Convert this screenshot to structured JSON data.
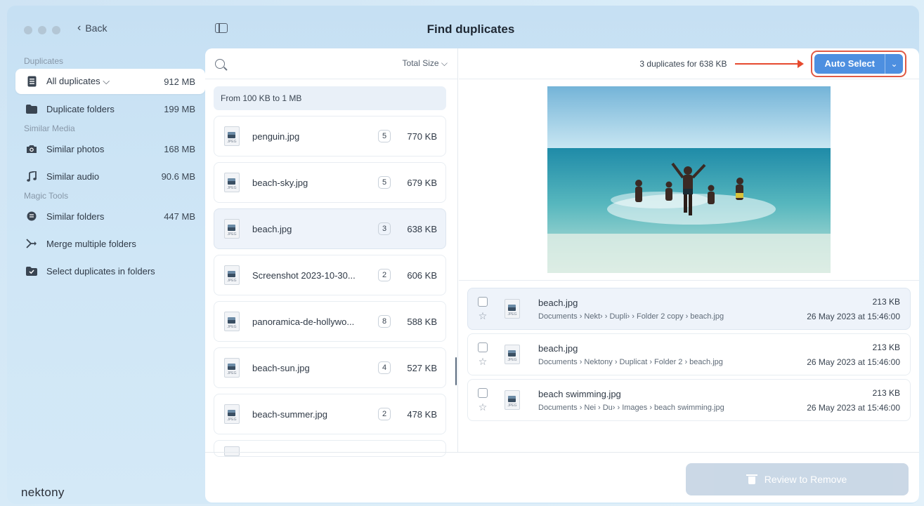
{
  "window": {
    "title": "Find duplicates",
    "back_label": "Back"
  },
  "sidebar": {
    "sections": [
      {
        "title": "Duplicates"
      },
      {
        "title": "Similar Media"
      },
      {
        "title": "Magic Tools"
      }
    ],
    "items": [
      {
        "label": "All duplicates ⌵",
        "size": "912 MB",
        "icon": "document-icon"
      },
      {
        "label": "Duplicate folders",
        "size": "199 MB",
        "icon": "folder-icon"
      },
      {
        "label": "Similar photos",
        "size": "168 MB",
        "icon": "camera-icon"
      },
      {
        "label": "Similar audio",
        "size": "90.6 MB",
        "icon": "music-note-icon"
      },
      {
        "label": "Similar folders",
        "size": "447 MB",
        "icon": "similar-folders-icon"
      },
      {
        "label": "Merge multiple folders",
        "size": "",
        "icon": "merge-icon"
      },
      {
        "label": "Select duplicates in folders",
        "size": "",
        "icon": "folder-check-icon"
      }
    ],
    "logo": "nektony"
  },
  "list": {
    "sort_label": "Total Size ⌵",
    "group_title": "From 100 KB to 1 MB",
    "files": [
      {
        "name": "penguin.jpg",
        "count": "5",
        "size": "770 KB"
      },
      {
        "name": "beach-sky.jpg",
        "count": "5",
        "size": "679 KB"
      },
      {
        "name": "beach.jpg",
        "count": "3",
        "size": "638 KB"
      },
      {
        "name": "Screenshot 2023-10-30...",
        "count": "2",
        "size": "606 KB"
      },
      {
        "name": "panoramica-de-hollywo...",
        "count": "8",
        "size": "588 KB"
      },
      {
        "name": "beach-sun.jpg",
        "count": "4",
        "size": "527 KB"
      },
      {
        "name": "beach-summer.jpg",
        "count": "2",
        "size": "478 KB"
      }
    ],
    "jpg_tag": "JPEG"
  },
  "detail": {
    "summary": "3 duplicates for 638 KB",
    "auto_select_label": "Auto Select",
    "duplicates": [
      {
        "name": "beach.jpg",
        "path": "Documents › Nekt› › Dupli› › Folder 2 copy › beach.jpg",
        "size": "213 KB",
        "date": "26 May 2023 at 15:46:00"
      },
      {
        "name": "beach.jpg",
        "path": "Documents › Nektony › Duplicat › Folder 2 › beach.jpg",
        "size": "213 KB",
        "date": "26 May 2023 at 15:46:00"
      },
      {
        "name": "beach swimming.jpg",
        "path": "Documents › Nei › Du› › Images › beach swimming.jpg",
        "size": "213 KB",
        "date": "26 May 2023 at 15:46:00"
      }
    ],
    "review_label": "Review to Remove"
  },
  "colors": {
    "accent": "#4d8fe0",
    "highlight_arrow": "#e64a2e",
    "disabled_button": "#c8d6e5"
  }
}
